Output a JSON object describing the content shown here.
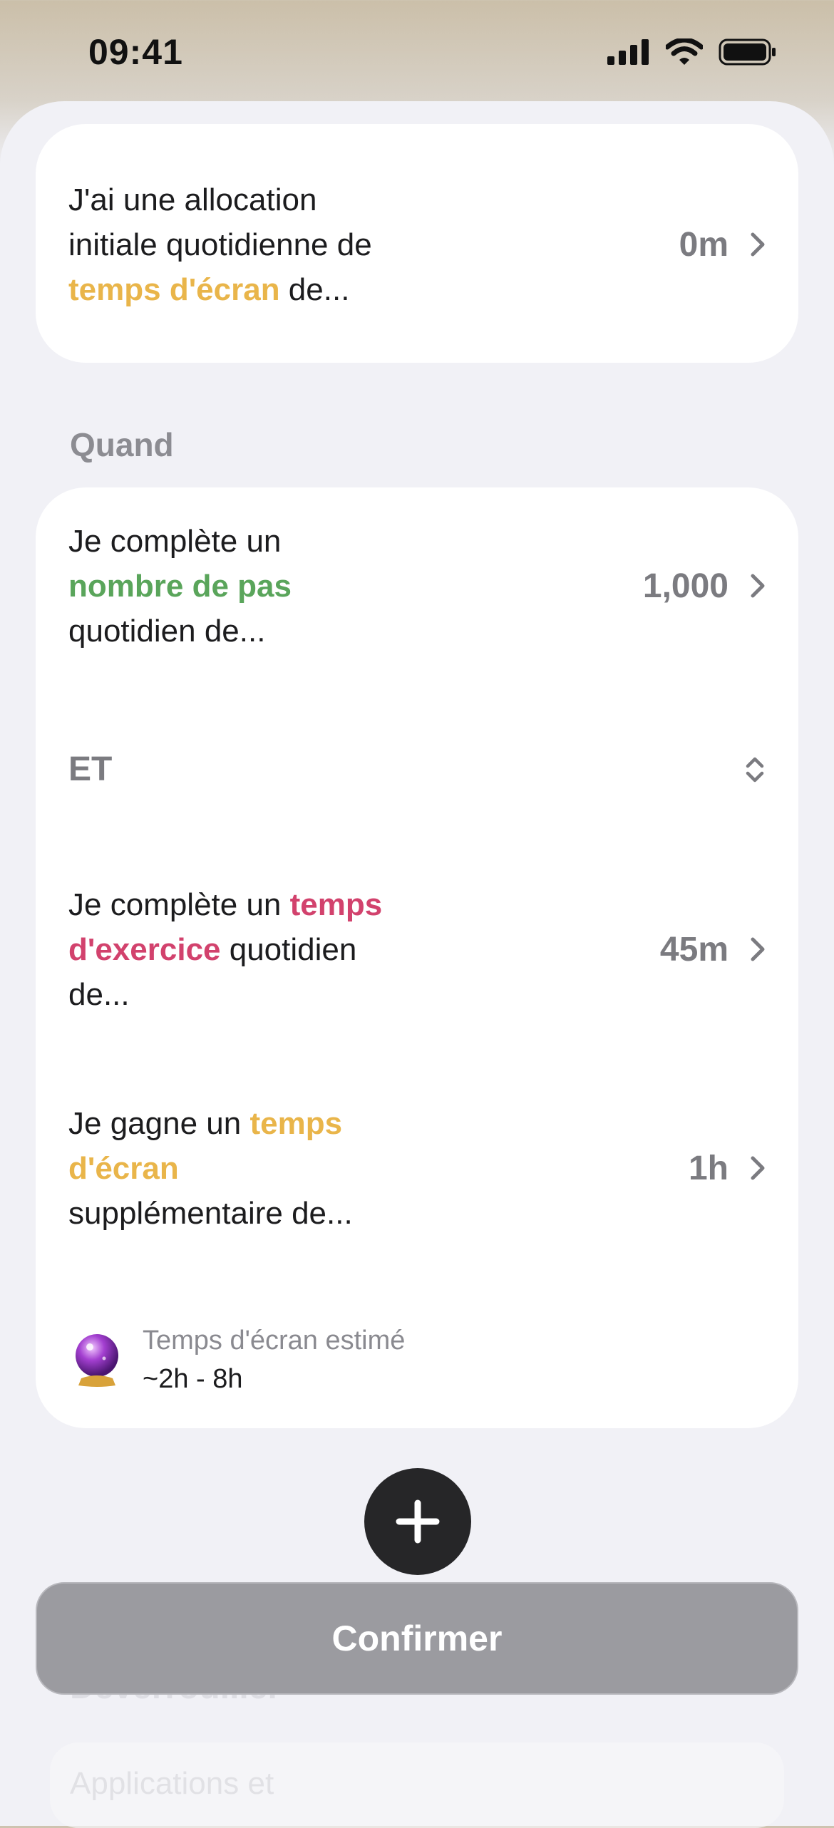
{
  "status_bar": {
    "time": "09:41"
  },
  "card_allocation": {
    "text_before": "J'ai une allocation initiale quotidienne de ",
    "highlight": "temps d'écran",
    "text_after": " de...",
    "value": "0m"
  },
  "section_when": {
    "label": "Quand"
  },
  "rule_steps": {
    "text_before": "Je complète un ",
    "highlight": "nombre de pas",
    "text_after": " quotidien de...",
    "value": "1,000"
  },
  "operator": {
    "label": "ET"
  },
  "rule_exercise": {
    "text_before": "Je complète un ",
    "highlight": "temps d'exercice",
    "text_after": " quotidien de...",
    "value": "45m"
  },
  "reward": {
    "text_before": "Je gagne un ",
    "highlight": "temps d'écran",
    "text_after": " supplémentaire de...",
    "value": "1h"
  },
  "estimate": {
    "title": "Temps d'écran estimé",
    "value": "~2h - 8h"
  },
  "confirm": {
    "label": "Confirmer"
  },
  "faded_behind": {
    "heading": "Déverrouiller",
    "item": "Applications et"
  },
  "colors": {
    "screen_time": "#e9b54a",
    "steps": "#5aa55b",
    "exercise": "#d2426d"
  }
}
